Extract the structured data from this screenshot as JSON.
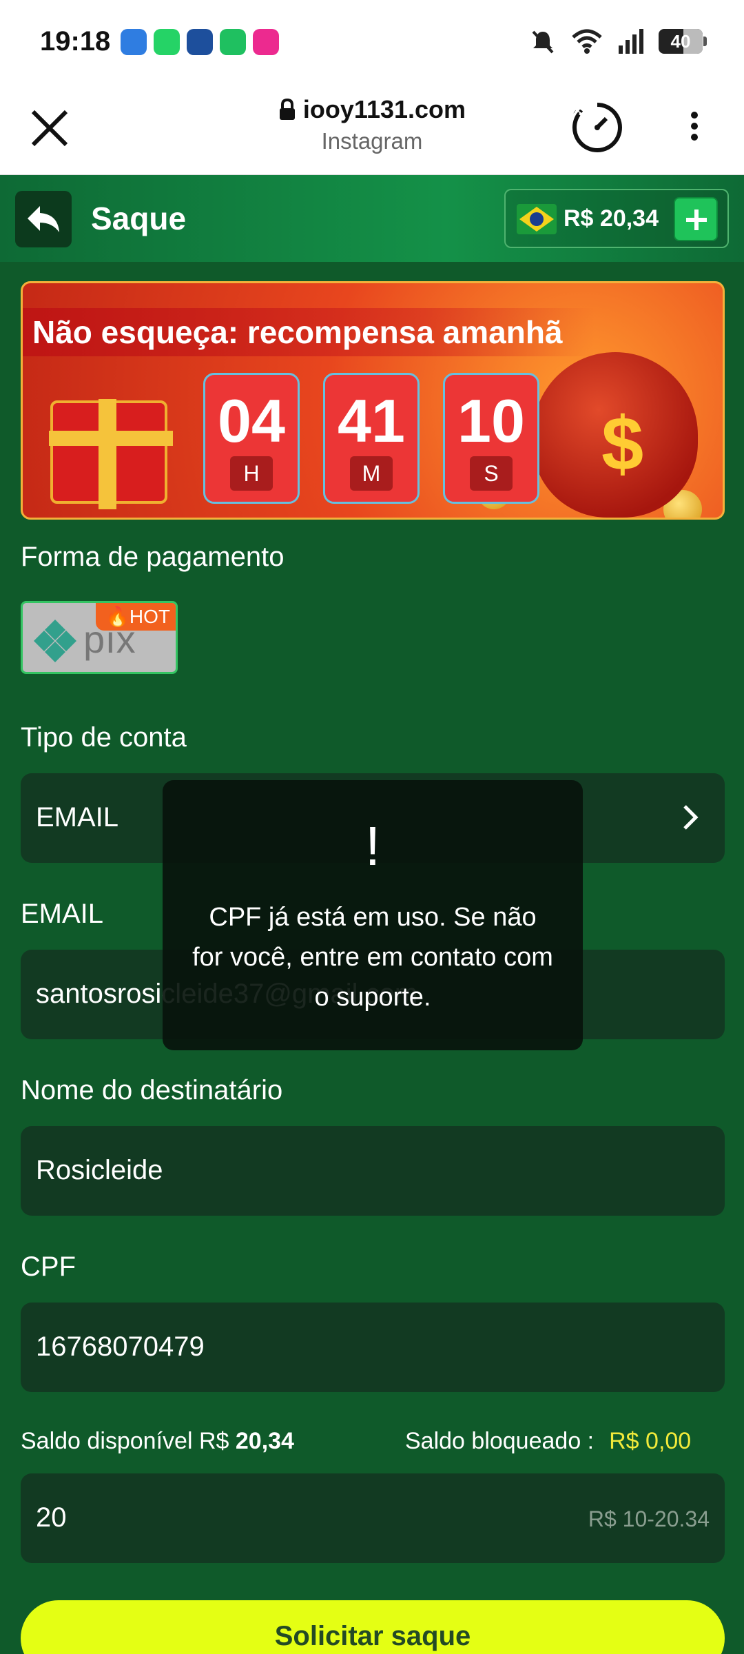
{
  "status_bar": {
    "time": "19:18",
    "battery": "40",
    "app_icons": [
      "browser-app-icon",
      "whatsapp-icon",
      "app-icon",
      "whatsapp-business-icon",
      "app-icon"
    ]
  },
  "browser": {
    "url": "iooy1131.com",
    "subtitle": "Instagram"
  },
  "header": {
    "title": "Saque",
    "balance": "R$ 20,34"
  },
  "banner": {
    "title": "Não esqueça: recompensa amanhã",
    "countdown": [
      {
        "value": "04",
        "unit": "H"
      },
      {
        "value": "41",
        "unit": "M"
      },
      {
        "value": "10",
        "unit": "S"
      }
    ]
  },
  "form": {
    "payment_label": "Forma de pagamento",
    "payment_method": {
      "name": "pix",
      "badge": "HOT"
    },
    "account_type_label": "Tipo de conta",
    "account_type_value": "EMAIL",
    "email_label": "EMAIL",
    "email_value": "santosrosicleide37@gmail.com",
    "recipient_label": "Nome do destinatário",
    "recipient_value": "Rosicleide",
    "cpf_label": "CPF",
    "cpf_value": "16768070479",
    "saldo_disponivel_label": "Saldo disponível R$",
    "saldo_disponivel_value": "20,34",
    "saldo_bloqueado_label": "Saldo bloqueado :",
    "saldo_bloqueado_value": "R$ 0,00",
    "amount_value": "20",
    "amount_range": "R$ 10-20.34",
    "submit_label": "Solicitar saque"
  },
  "toast": {
    "icon": "!",
    "message": "CPF já está em uso. Se não for você, entre em contato com o suporte."
  },
  "colors": {
    "background": "#0f5a2a",
    "field": "#123a22",
    "accent": "#e4ff14",
    "blocked_amount": "#f2ea3a",
    "hot_badge": "#f2611e"
  }
}
